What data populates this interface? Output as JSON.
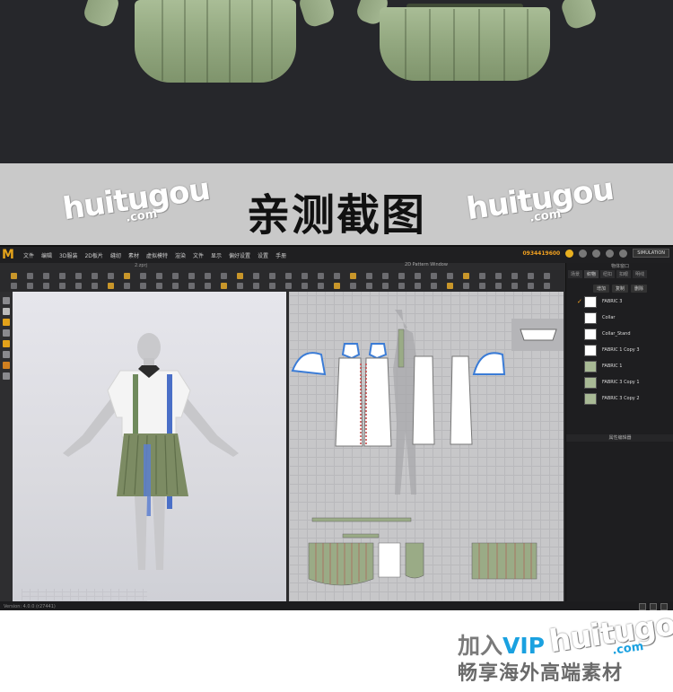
{
  "banner": {
    "title": "亲测截图",
    "watermark_main": "huitugou",
    "watermark_sub": ".com"
  },
  "app": {
    "logo": "M",
    "menu": [
      "文件",
      "编辑",
      "3D服装",
      "2D板片",
      "缝纫",
      "素材",
      "虚拟模特",
      "渲染",
      "文件",
      "显示",
      "偏好设置",
      "设置",
      "手册"
    ],
    "user_id": "0934419600",
    "simulation_label": "SIMULATION",
    "tab_3d": "2.zprj",
    "tab_2d": "2D Pattern Window",
    "colors": {
      "accent": "#e3a21a",
      "fabric_green": "#a8b995",
      "panel_bg": "#1e1e20"
    },
    "icons": {
      "help": "help-icon",
      "user": "user-icon",
      "settings": "gear-icon",
      "sim": "simulation-icon"
    },
    "panel": {
      "title": "物体窗口",
      "tabs": [
        "场景",
        "织物",
        "纽扣",
        "扣眼",
        "明线"
      ],
      "active_tab_index": 1,
      "actions": [
        "增加",
        "复制",
        "删除"
      ],
      "fabrics": [
        {
          "name": "FABRIC 3",
          "color": "#ffffff",
          "checked": true
        },
        {
          "name": "Collar",
          "color": "#ffffff",
          "checked": false
        },
        {
          "name": "Collar_Stand",
          "color": "#ffffff",
          "checked": false
        },
        {
          "name": "FABRIC 1 Copy 3",
          "color": "#ffffff",
          "checked": false
        },
        {
          "name": "FABRIC 1",
          "color": "#a8b995",
          "checked": false
        },
        {
          "name": "FABRIC 3 Copy 1",
          "color": "#a8b995",
          "checked": false
        },
        {
          "name": "FABRIC 3 Copy 2",
          "color": "#a8b995",
          "checked": false
        }
      ],
      "property_title": "属性编辑器"
    },
    "status_left": "Version: 4.0.0 (r27441)"
  },
  "footer": {
    "prefix": "加入",
    "vip": "VIP",
    "watermark_main": "huitugou",
    "watermark_sub": ".com",
    "line2": "畅享海外高端素材"
  }
}
